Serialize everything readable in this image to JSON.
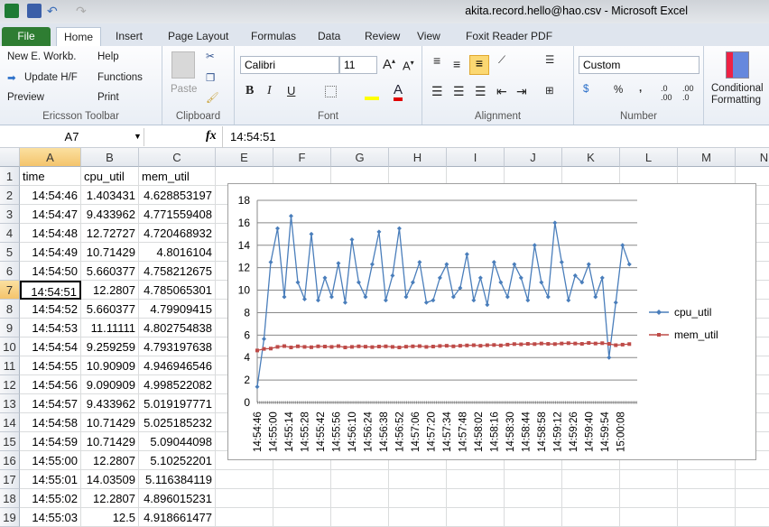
{
  "window": {
    "title": "akita.record.hello@hao.csv  -  Microsoft Excel"
  },
  "tabs": [
    "File",
    "Home",
    "Insert",
    "Page Layout",
    "Formulas",
    "Data",
    "Review",
    "View",
    "Foxit Reader PDF"
  ],
  "active_tab": "Home",
  "ribbon": {
    "ericsson": {
      "new_workbook": "New E. Workb.",
      "help": "Help",
      "update_hf": "Update H/F",
      "functions": "Functions",
      "preview": "Preview",
      "print": "Print",
      "label": "Ericsson Toolbar"
    },
    "clipboard": {
      "paste": "Paste",
      "label": "Clipboard"
    },
    "font": {
      "name": "Calibri",
      "size": "11",
      "bold": "B",
      "italic": "I",
      "underline": "U",
      "label": "Font",
      "fill_color": "#ffff00",
      "font_color": "#e00000"
    },
    "alignment": {
      "label": "Alignment"
    },
    "number": {
      "format": "Custom",
      "percent": "%",
      "comma": ",",
      "label": "Number"
    },
    "styles": {
      "conditional_formatting_1": "Conditional",
      "conditional_formatting_2": "Formatting"
    }
  },
  "formula_bar": {
    "name_box": "A7",
    "fx": "fx",
    "value": "14:54:51"
  },
  "columns": [
    "A",
    "B",
    "C",
    "E",
    "F",
    "G",
    "H",
    "I",
    "J",
    "K",
    "L",
    "M",
    "N"
  ],
  "selected_cell": "A7",
  "rows": [
    [
      "time",
      "cpu_util",
      "mem_util"
    ],
    [
      "14:54:46",
      "1.403431",
      "4.628853197"
    ],
    [
      "14:54:47",
      "9.433962",
      "4.771559408"
    ],
    [
      "14:54:48",
      "12.72727",
      "4.720468932"
    ],
    [
      "14:54:49",
      "10.71429",
      "4.8016104"
    ],
    [
      "14:54:50",
      "5.660377",
      "4.758212675"
    ],
    [
      "14:54:51",
      "12.2807",
      "4.785065301"
    ],
    [
      "14:54:52",
      "5.660377",
      "4.79909415"
    ],
    [
      "14:54:53",
      "11.11111",
      "4.802754838"
    ],
    [
      "14:54:54",
      "9.259259",
      "4.793197638"
    ],
    [
      "14:54:55",
      "10.90909",
      "4.946946546"
    ],
    [
      "14:54:56",
      "9.090909",
      "4.998522082"
    ],
    [
      "14:54:57",
      "9.433962",
      "5.019197771"
    ],
    [
      "14:54:58",
      "10.71429",
      "5.025185232"
    ],
    [
      "14:54:59",
      "10.71429",
      "5.09044098"
    ],
    [
      "14:55:00",
      "12.2807",
      "5.10252201"
    ],
    [
      "14:55:01",
      "14.03509",
      "5.116384119"
    ],
    [
      "14:55:02",
      "12.2807",
      "4.896015231"
    ],
    [
      "14:55:03",
      "12.5",
      "4.918661477"
    ]
  ],
  "chart_data": {
    "type": "line",
    "ylim": [
      0,
      18
    ],
    "yticks": [
      0,
      2,
      4,
      6,
      8,
      10,
      12,
      14,
      16,
      18
    ],
    "xlim": [
      "14:54:46",
      "15:00:23"
    ],
    "xtick_labels": [
      "14:54:46",
      "14:55:00",
      "14:55:14",
      "14:55:28",
      "14:55:42",
      "14:55:56",
      "14:56:10",
      "14:56:24",
      "14:56:38",
      "14:56:52",
      "14:57:06",
      "14:57:20",
      "14:57:34",
      "14:57:48",
      "14:58:02",
      "14:58:16",
      "14:58:30",
      "14:58:44",
      "14:58:58",
      "14:59:12",
      "14:59:26",
      "14:59:40",
      "14:59:54",
      "15:00:08"
    ],
    "grid": true,
    "legend": "right",
    "x": [
      "14:54:46",
      "14:54:52",
      "14:54:58",
      "14:55:04",
      "14:55:10",
      "14:55:16",
      "14:55:22",
      "14:55:28",
      "14:55:34",
      "14:55:40",
      "14:55:46",
      "14:55:52",
      "14:55:58",
      "14:56:04",
      "14:56:10",
      "14:56:16",
      "14:56:22",
      "14:56:28",
      "14:56:34",
      "14:56:40",
      "14:56:46",
      "14:56:52",
      "14:56:58",
      "14:57:04",
      "14:57:10",
      "14:57:16",
      "14:57:22",
      "14:57:28",
      "14:57:34",
      "14:57:40",
      "14:57:46",
      "14:57:52",
      "14:57:58",
      "14:58:04",
      "14:58:10",
      "14:58:16",
      "14:58:22",
      "14:58:28",
      "14:58:34",
      "14:58:40",
      "14:58:46",
      "14:58:52",
      "14:58:58",
      "14:59:04",
      "14:59:10",
      "14:59:16",
      "14:59:22",
      "14:59:28",
      "14:59:34",
      "14:59:40",
      "14:59:46",
      "14:59:52",
      "14:59:58",
      "15:00:04",
      "15:00:10",
      "15:00:16"
    ],
    "series": [
      {
        "name": "cpu_util",
        "color": "#4a7ebb",
        "values": [
          1.4,
          5.66,
          12.5,
          15.5,
          9.4,
          16.6,
          10.7,
          9.2,
          15.0,
          9.1,
          11.1,
          9.4,
          12.4,
          8.9,
          14.5,
          10.7,
          9.4,
          12.3,
          15.2,
          9.1,
          11.3,
          15.5,
          9.4,
          10.7,
          12.5,
          8.9,
          9.1,
          11.1,
          12.3,
          9.4,
          10.2,
          13.2,
          9.1,
          11.1,
          8.7,
          12.5,
          10.7,
          9.4,
          12.3,
          11.1,
          9.1,
          14.0,
          10.7,
          9.4,
          16.0,
          12.5,
          9.1,
          11.3,
          10.7,
          12.3,
          9.4,
          11.1,
          4.0,
          8.9,
          14.0,
          12.3
        ]
      },
      {
        "name": "mem_util",
        "color": "#be4b48",
        "values": [
          4.63,
          4.77,
          4.8,
          4.95,
          5.02,
          4.9,
          5.0,
          4.95,
          4.92,
          5.0,
          4.98,
          4.95,
          5.02,
          4.9,
          4.95,
          5.0,
          4.97,
          4.93,
          4.98,
          5.0,
          4.95,
          4.9,
          4.97,
          5.0,
          5.02,
          4.95,
          4.98,
          5.03,
          5.05,
          5.0,
          5.05,
          5.08,
          5.1,
          5.05,
          5.1,
          5.12,
          5.08,
          5.15,
          5.2,
          5.18,
          5.22,
          5.2,
          5.25,
          5.22,
          5.2,
          5.25,
          5.28,
          5.25,
          5.22,
          5.3,
          5.25,
          5.28,
          5.22,
          5.1,
          5.15,
          5.2
        ]
      }
    ]
  }
}
